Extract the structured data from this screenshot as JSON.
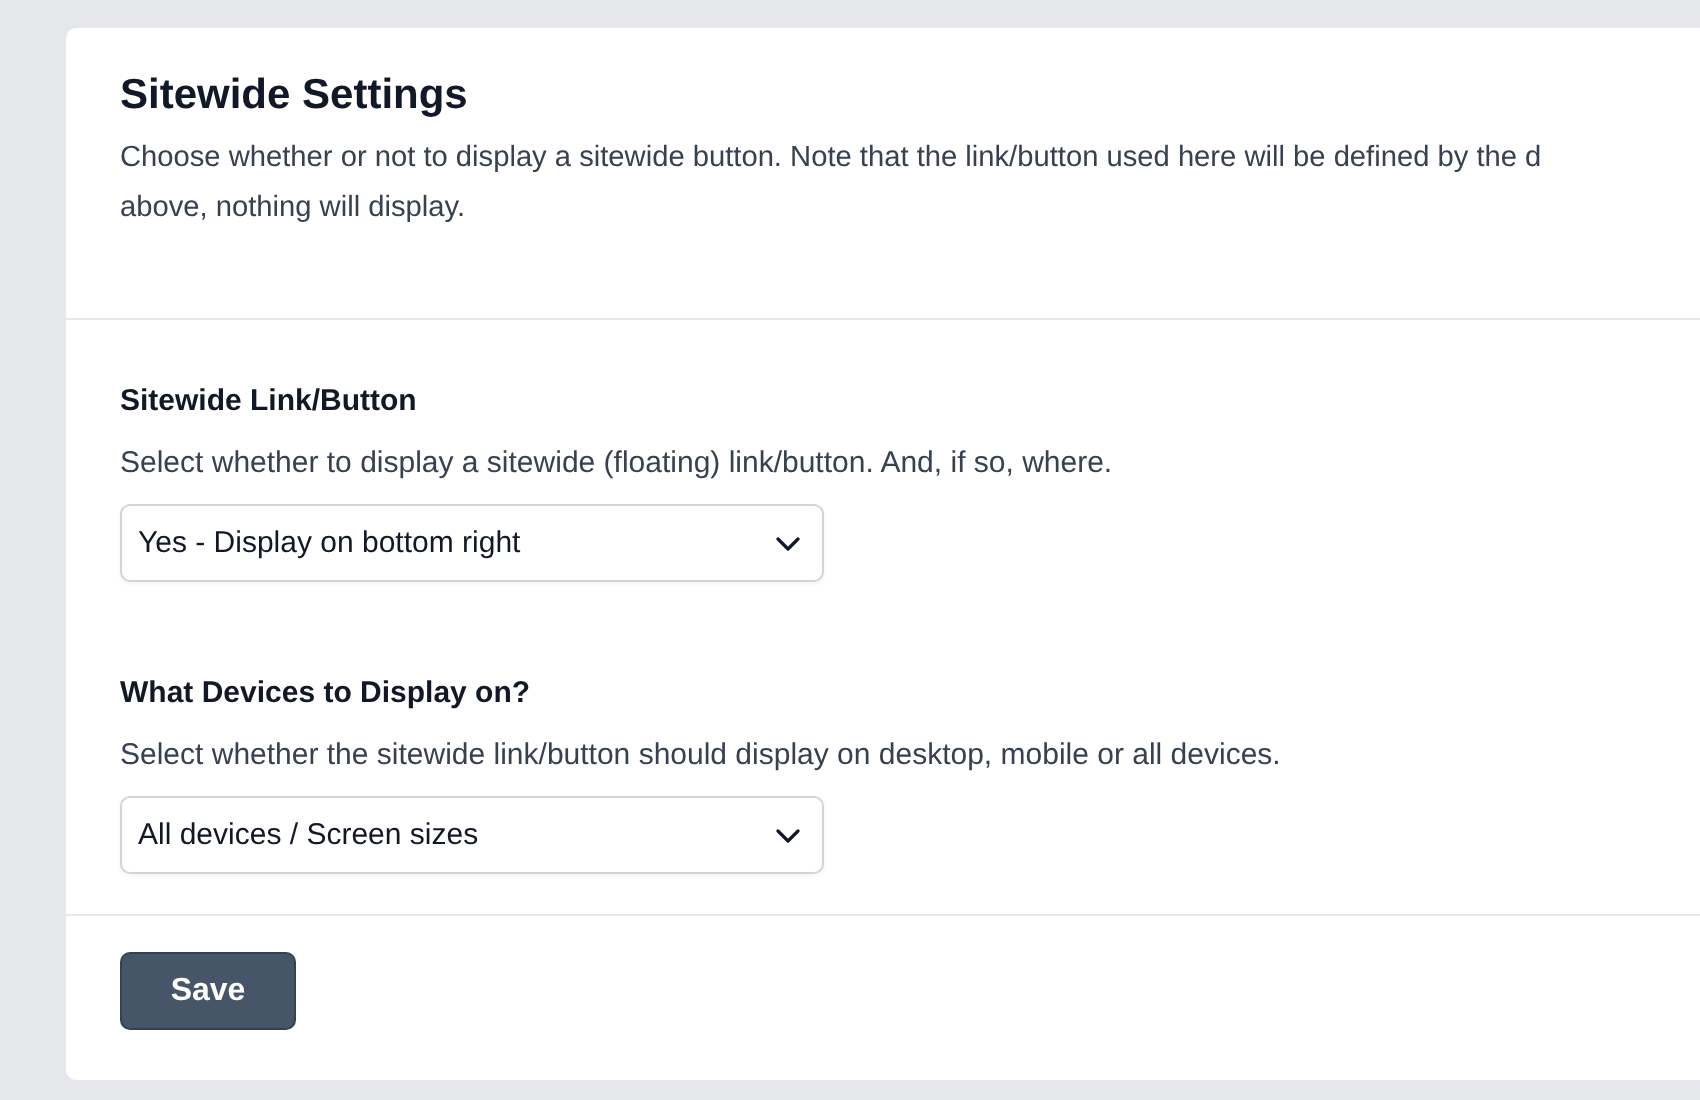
{
  "header": {
    "title": "Sitewide Settings",
    "description_lines": [
      "Choose whether or not to display a sitewide button. Note that the link/button used here will be defined by the d",
      "above, nothing will display."
    ]
  },
  "fields": [
    {
      "label": "Sitewide Link/Button",
      "help": "Select whether to display a sitewide (floating) link/button. And, if so, where.",
      "value": "Yes - Display on bottom right"
    },
    {
      "label": "What Devices to Display on?",
      "help": "Select whether the sitewide link/button should display on desktop, mobile or all devices.",
      "value": "All devices / Screen sizes"
    }
  ],
  "save_button": "Save"
}
